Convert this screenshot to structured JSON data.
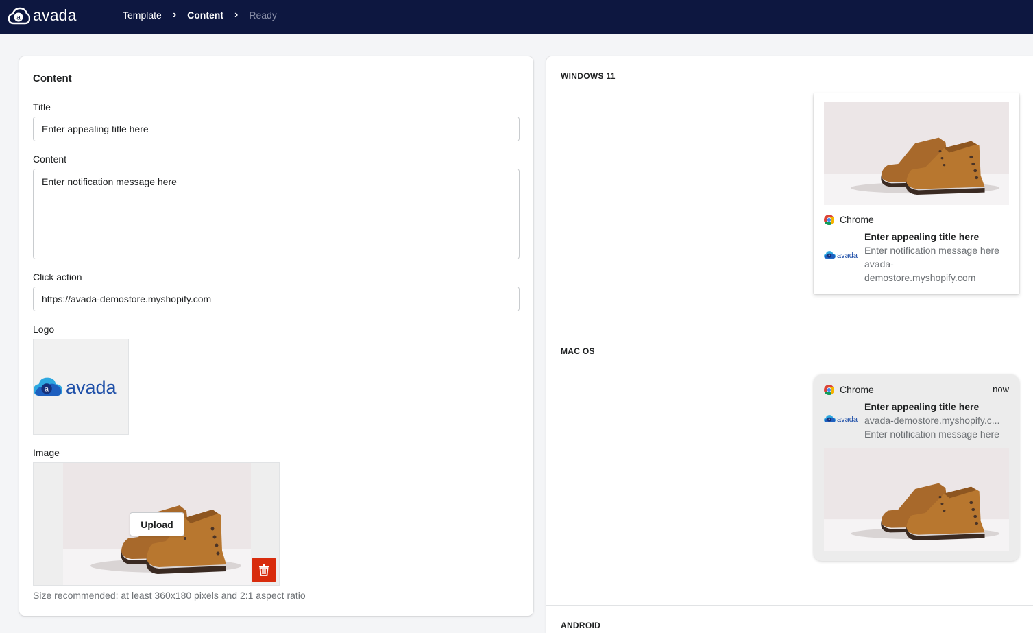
{
  "nav": {
    "brand": "avada",
    "crumbs": [
      {
        "label": "Template"
      },
      {
        "label": "Content"
      },
      {
        "label": "Ready"
      }
    ]
  },
  "content": {
    "heading": "Content",
    "title_label": "Title",
    "title_value": "Enter appealing title here",
    "content_label": "Content",
    "content_value": "Enter notification message here",
    "click_label": "Click action",
    "click_value": "https://avada-demostore.myshopify.com",
    "logo_label": "Logo",
    "logo_text": "avada",
    "image_label": "Image",
    "upload_label": "Upload",
    "hint": "Size recommended: at least 360x180 pixels and 2:1 aspect ratio"
  },
  "preview": {
    "windows": {
      "section": "WINDOWS 11",
      "app": "Chrome",
      "title": "Enter appealing title here",
      "message": "Enter notification message here",
      "site_line1": "avada-",
      "site_line2": "demostore.myshopify.com",
      "logo_text": "avada"
    },
    "mac": {
      "section": "MAC OS",
      "app": "Chrome",
      "time": "now",
      "title": "Enter appealing title here",
      "site": "avada-demostore.myshopify.c...",
      "message": "Enter notification message here",
      "logo_text": "avada"
    },
    "android": {
      "section": "ANDROID"
    }
  },
  "colors": {
    "nav_bg": "#0d1740",
    "brand_blue": "#1e5fbf",
    "brand_light": "#2ea8e0",
    "danger": "#d82c0d"
  }
}
